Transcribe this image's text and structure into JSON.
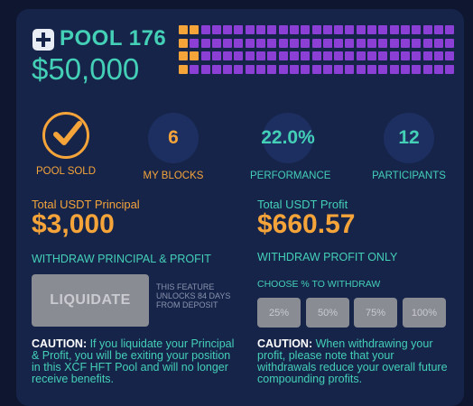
{
  "pool": {
    "name": "POOL 176",
    "amount": "$50,000",
    "blocks": {
      "total": 100,
      "sold_by_me": 6,
      "sold_color": "#f5a43a",
      "other_color": "#8b3fd4"
    }
  },
  "stats": [
    {
      "id": "pool-sold",
      "value": "",
      "label": "POOL SOLD",
      "icon": "check-icon",
      "color": "#f5a43a"
    },
    {
      "id": "my-blocks",
      "value": "6",
      "label": "MY BLOCKS",
      "color": "#f5a43a"
    },
    {
      "id": "performance",
      "value": "22.0%",
      "label": "PERFORMANCE",
      "color": "#44d0b7"
    },
    {
      "id": "participants",
      "value": "12",
      "label": "PARTICIPANTS",
      "color": "#44d0b7"
    }
  ],
  "principal": {
    "title": "Total USDT Principal",
    "amount": "$3,000",
    "withdraw_label": "WITHDRAW PRINCIPAL & PROFIT",
    "button_label": "LIQUIDATE",
    "feature_note": "THIS FEATURE UNLOCKS 84 DAYS FROM DEPOSIT",
    "caution_bold": "CAUTION:",
    "caution_text": " If you liquidate your Principal & Profit, you will be exiting your position in this XCF HFT Pool and will no longer receive benefits."
  },
  "profit": {
    "title": "Total USDT Profit",
    "amount": "$660.57",
    "withdraw_label": "WITHDRAW PROFIT ONLY",
    "choose_label": "CHOOSE % TO WITHDRAW",
    "options": [
      "25%",
      "50%",
      "75%",
      "100%"
    ],
    "caution_bold": "CAUTION:",
    "caution_text": " When withdrawing your profit, please note that your withdrawals reduce your overall future compounding profits."
  },
  "colors": {
    "accent_orange": "#f5a43a",
    "accent_teal": "#44d0b7",
    "card_bg": "#16244a"
  }
}
